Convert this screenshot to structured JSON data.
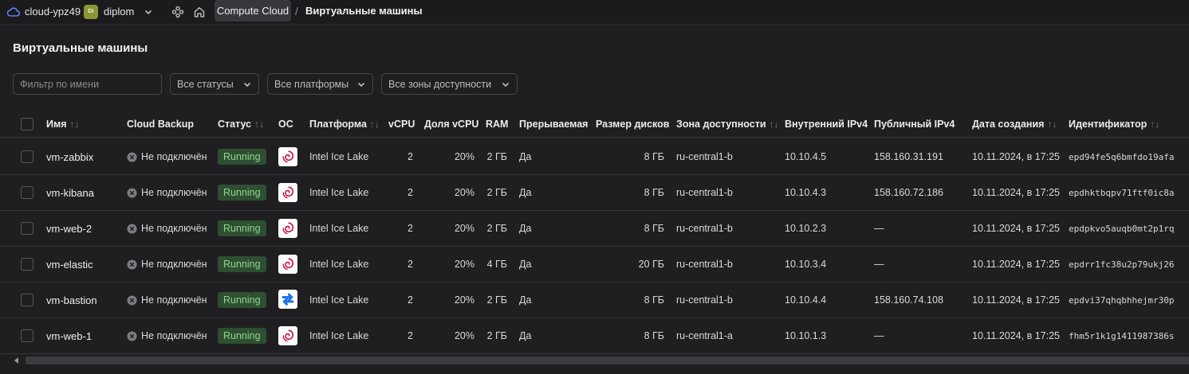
{
  "topbar": {
    "cloud_name": "cloud-ypz49",
    "folder_badge": "DI",
    "folder_name": "diplom",
    "service_crumb": "Compute Cloud",
    "separator": "/",
    "current_crumb": "Виртуальные машины"
  },
  "page": {
    "title": "Виртуальные машины"
  },
  "filters": {
    "name_placeholder": "Фильтр по имени",
    "status_select": "Все статусы",
    "platform_select": "Все платформы",
    "zone_select": "Все зоны доступности"
  },
  "table": {
    "columns": {
      "name": "Имя",
      "backup": "Cloud Backup",
      "status": "Статус",
      "os": "ОС",
      "platform": "Платформа",
      "vcpu": "vCPU",
      "vcpu_share": "Доля vCPU",
      "ram": "RAM",
      "preemptible": "Прерываемая",
      "disk_size": "Размер дисков",
      "zone": "Зона доступности",
      "ipv4_internal": "Внутренний IPv4",
      "ipv4_public": "Публичный IPv4",
      "created": "Дата создания",
      "id": "Идентификатор"
    },
    "sort_glyph": "↑↓",
    "rows": [
      {
        "name": "vm-zabbix",
        "backup": "Не подключён",
        "status": "Running",
        "os": "debian-icon",
        "platform": "Intel Ice Lake",
        "vcpu": "2",
        "vcpu_share": "20%",
        "ram": "2 ГБ",
        "preemptible": "Да",
        "disk_size": "8 ГБ",
        "zone": "ru-central1-b",
        "ipv4_internal": "10.10.4.5",
        "ipv4_public": "158.160.31.191",
        "created": "10.11.2024, в 17:25",
        "id": "epd94fe5q6bmfdo19afa"
      },
      {
        "name": "vm-kibana",
        "backup": "Не подключён",
        "status": "Running",
        "os": "debian-icon",
        "platform": "Intel Ice Lake",
        "vcpu": "2",
        "vcpu_share": "20%",
        "ram": "2 ГБ",
        "preemptible": "Да",
        "disk_size": "8 ГБ",
        "zone": "ru-central1-b",
        "ipv4_internal": "10.10.4.3",
        "ipv4_public": "158.160.72.186",
        "created": "10.11.2024, в 17:25",
        "id": "epdhktbqpv71ftf0ic8a"
      },
      {
        "name": "vm-web-2",
        "backup": "Не подключён",
        "status": "Running",
        "os": "debian-icon",
        "platform": "Intel Ice Lake",
        "vcpu": "2",
        "vcpu_share": "20%",
        "ram": "2 ГБ",
        "preemptible": "Да",
        "disk_size": "8 ГБ",
        "zone": "ru-central1-b",
        "ipv4_internal": "10.10.2.3",
        "ipv4_public": "—",
        "created": "10.11.2024, в 17:25",
        "id": "epdpkvo5auqb0mt2p1rq"
      },
      {
        "name": "vm-elastic",
        "backup": "Не подключён",
        "status": "Running",
        "os": "debian-icon",
        "platform": "Intel Ice Lake",
        "vcpu": "2",
        "vcpu_share": "20%",
        "ram": "4 ГБ",
        "preemptible": "Да",
        "disk_size": "20 ГБ",
        "zone": "ru-central1-b",
        "ipv4_internal": "10.10.3.4",
        "ipv4_public": "—",
        "created": "10.11.2024, в 17:25",
        "id": "epdrr1fc38u2p79ukj26"
      },
      {
        "name": "vm-bastion",
        "backup": "Не подключён",
        "status": "Running",
        "os": "nat-instance-icon",
        "platform": "Intel Ice Lake",
        "vcpu": "2",
        "vcpu_share": "20%",
        "ram": "2 ГБ",
        "preemptible": "Да",
        "disk_size": "8 ГБ",
        "zone": "ru-central1-b",
        "ipv4_internal": "10.10.4.4",
        "ipv4_public": "158.160.74.108",
        "created": "10.11.2024, в 17:25",
        "id": "epdvi37qhqbhhejmr30p"
      },
      {
        "name": "vm-web-1",
        "backup": "Не подключён",
        "status": "Running",
        "os": "debian-icon",
        "platform": "Intel Ice Lake",
        "vcpu": "2",
        "vcpu_share": "20%",
        "ram": "2 ГБ",
        "preemptible": "Да",
        "disk_size": "8 ГБ",
        "zone": "ru-central1-a",
        "ipv4_internal": "10.10.1.3",
        "ipv4_public": "—",
        "created": "10.11.2024, в 17:25",
        "id": "fhm5r1k1g1411987386s"
      }
    ]
  },
  "colors": {
    "background": "#1f1f22",
    "status_running_bg": "#2e4f31",
    "status_running_text": "#8fd58e",
    "folder_badge": "#8c9635"
  }
}
